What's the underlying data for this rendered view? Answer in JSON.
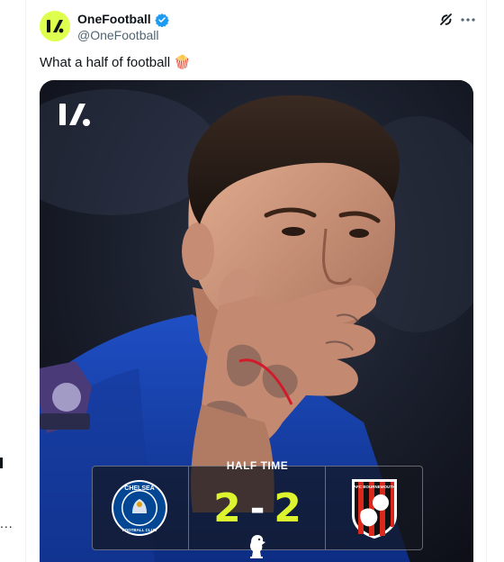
{
  "tweet": {
    "author_name": "OneFootball",
    "handle": "@OneFootball",
    "verified": true,
    "text": "What a half of football",
    "emoji": "🍿"
  },
  "scoreboard": {
    "status": "HALF TIME",
    "home_score": "2",
    "separator": "-",
    "away_score": "2",
    "home_crest_text": "CHELSEA",
    "home_crest_subtext": "FOOTBALL CLUB",
    "away_crest_text": "AFC BOURNEMOUTH"
  },
  "sidebar": {
    "more_label": "..."
  },
  "icons": {
    "avatar": "onefootball-logo-icon",
    "verified": "verified-badge-icon",
    "grok": "grok-icon",
    "more": "more-icon",
    "brand": "onefootball-brand-icon",
    "league": "premier-league-icon"
  },
  "colors": {
    "brand_accent": "#dfff4f",
    "score_color": "#dcf52e",
    "verified_blue": "#1d9bf0",
    "handle_gray": "#536471",
    "chelsea_blue": "#034694",
    "bournemouth_red": "#da291c"
  }
}
